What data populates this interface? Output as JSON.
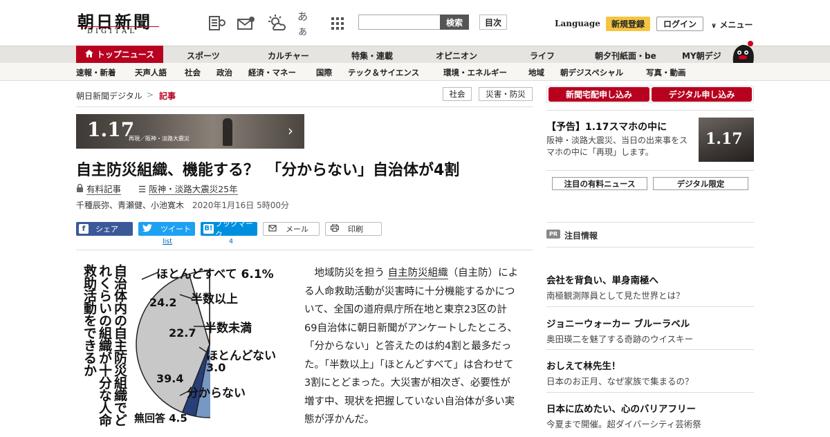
{
  "header": {
    "logo_main": "朝日新聞",
    "logo_sub": "DIGITAL",
    "icons": [
      "newspaper-icon",
      "mail-icon",
      "weather-icon",
      "font-size-icon",
      "grid-icon"
    ],
    "font_size_glyph": "あぁ",
    "search_placeholder": "",
    "search_button": "検索",
    "toc_button": "目次",
    "language": "Language",
    "register": "新規登録",
    "login": "ログイン",
    "menu": "メニュー"
  },
  "nav_main": {
    "top_news": "トップニュース",
    "items": [
      "スポーツ",
      "カルチャー",
      "特集・連載",
      "オピニオン",
      "ライフ",
      "朝夕刊紙面・be",
      "MY朝デジ"
    ]
  },
  "nav_sub": {
    "items": [
      "速報・新着",
      "天声人語",
      "社会",
      "政治",
      "経済・マネー",
      "国際",
      "テック＆サイエンス",
      "環境・エネルギー",
      "地域",
      "朝デジスペシャル",
      "写真・動画"
    ]
  },
  "breadcrumb": {
    "home": "朝日新聞デジタル",
    "sep": ">",
    "current": "記事"
  },
  "tags": [
    "社会",
    "災害・防災"
  ],
  "banner": {
    "num": "1.17",
    "sub": "再現／阪神・淡路大震災"
  },
  "article": {
    "title": "自主防災組織、機能する？　「分からない」自治体が4割",
    "paid": "有料記事",
    "series": "阪神・淡路大震災25年",
    "authors": "千種辰弥、青瀬健、小池寛木",
    "date": "2020年1月16日 5時00分",
    "body_pre": "地域防災を担う",
    "body_link": "自主防災組織",
    "body_post": "（自主防）による人命救助活動が災害時に十分機能するかについて、全国の道府県庁所在地と東京23区の計69自治体に朝日新聞がアンケートしたところ、「分からない」と答えたのは約4割と最多だった。「半数以上」「ほとんどすべて」は合わせて3割にとどまった。大災害が相次ぎ、必要性が増す中、現状を把握していない自治体が多い実態が浮かんだ。"
  },
  "share": {
    "facebook": "シェア",
    "twitter": "ツイート",
    "twitter_count": "list",
    "hatena": "ブックマーク",
    "hatena_count": "4",
    "mail": "メール",
    "print": "印刷"
  },
  "chart_data": {
    "type": "pie",
    "title": "自治体内の自主防災組織でどれくらいの組織が十分な人命救助活動をできるか",
    "categories": [
      "ほとんどすべて",
      "半数以上",
      "半数未満",
      "ほとんどない",
      "分からない",
      "無回答"
    ],
    "values": [
      6.1,
      24.2,
      22.7,
      3.0,
      39.4,
      4.5
    ],
    "colors": [
      "#e0641e",
      "#e8b455",
      "#7797c4",
      "#27407a",
      "#c8c8c8",
      "#ffffff"
    ],
    "labels": [
      "ほとんどすべて 6.1%",
      "半数以上",
      "半数未満",
      "ほとんどない",
      "分からない",
      "無回答 4.5"
    ],
    "value_labels": [
      "24.2",
      "22.7",
      "3.0",
      "39.4"
    ]
  },
  "sidebar": {
    "buttons": [
      "新聞宅配申し込み",
      "デジタル申し込み"
    ],
    "ad_title": "【予告】1.17スマホの中に",
    "ad_desc": "阪神・淡路大震災、当日の出来事をスマホの中に「再現」します。",
    "ad_img_num": "1.17",
    "pills": [
      "注目の有料ニュース",
      "デジタル限定"
    ],
    "pr_badge": "PR",
    "pr_label": "注目情報",
    "promos": [
      {
        "title": "会社を背負い、単身南極へ",
        "desc": "南極観測隊員として見た世界とは？"
      },
      {
        "title": "ジョニーウォーカー ブルーラベル",
        "desc": "奥田瑛二を魅了する奇跡のウイスキー"
      },
      {
        "title": "おしえて林先生！",
        "desc": "日本のお正月、なぜ家族で集まるの？"
      },
      {
        "title": "日本に広めたい、心のバリアフリー",
        "desc": "今夏まで開催。超ダイバーシティ芸術祭"
      }
    ]
  }
}
